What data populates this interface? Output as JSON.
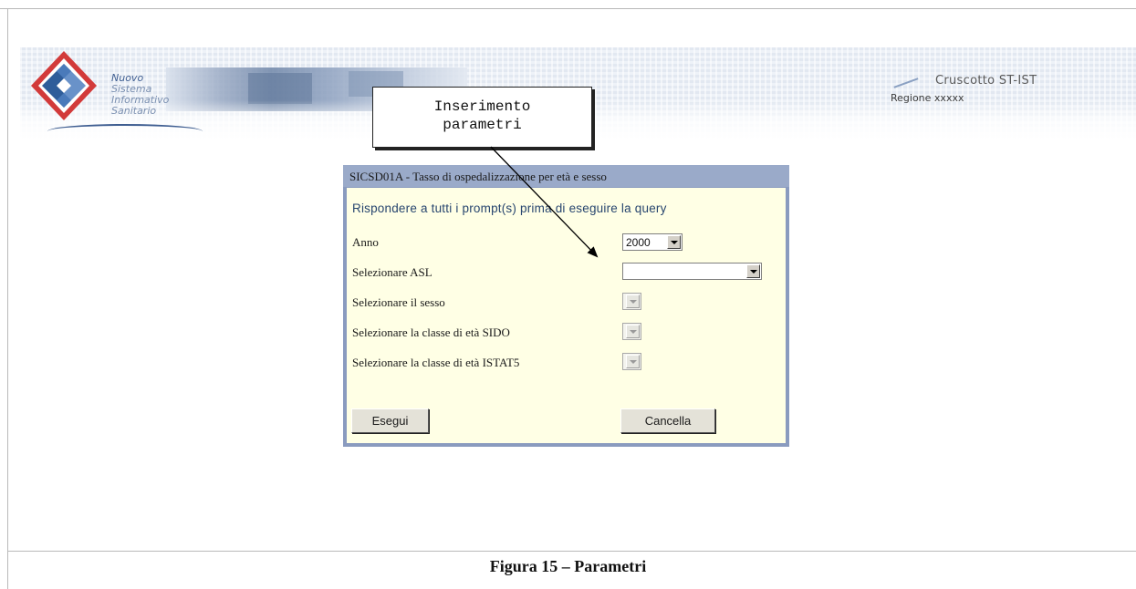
{
  "header": {
    "logo_lines": [
      "Nuovo",
      "Sistema",
      "Informativo",
      "Sanitario"
    ],
    "app_title": "Cruscotto ST-IST",
    "region": "Regione xxxxx"
  },
  "callout": {
    "line1": "Inserimento",
    "line2": "parametri"
  },
  "form": {
    "title": "SICSD01A - Tasso di ospedalizzazione per età e sesso",
    "prompt": "Rispondere a tutti i prompt(s) prima di eseguire la query",
    "fields": [
      {
        "label": "Anno",
        "value": "2000",
        "enabled": true
      },
      {
        "label": "Selezionare ASL",
        "value": "",
        "enabled": true
      },
      {
        "label": "Selezionare il sesso",
        "value": "",
        "enabled": false
      },
      {
        "label": "Selezionare la classe di età SIDO",
        "value": "",
        "enabled": false
      },
      {
        "label": "Selezionare la classe di età ISTAT5",
        "value": "",
        "enabled": false
      }
    ],
    "execute_label": "Esegui",
    "cancel_label": "Cancella"
  },
  "caption": "Figura 15 – Parametri",
  "colors": {
    "panel_border": "#8a9bbf",
    "panel_background": "#ffffe5",
    "prompt_text": "#28466f"
  }
}
